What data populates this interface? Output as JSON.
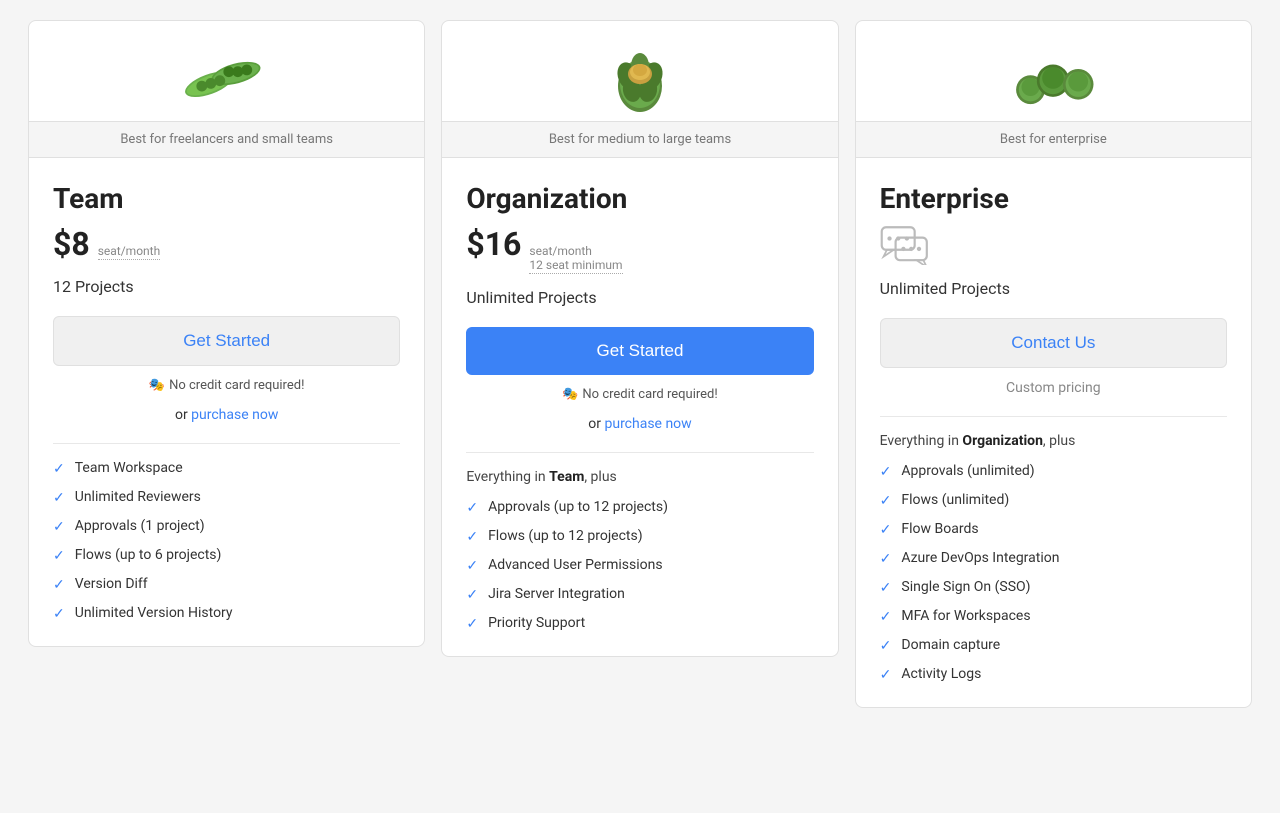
{
  "cards": [
    {
      "id": "team",
      "veggie": "🫛",
      "veggie_name": "edamame",
      "header": "Best for freelancers and small teams",
      "plan_name": "Team",
      "price": "$8",
      "price_detail_line1": "seat/month",
      "price_detail_line2": "",
      "projects": "12 Projects",
      "btn_label": "Get Started",
      "btn_style": "outline",
      "no_credit": "No credit card required!",
      "purchase_prefix": "or",
      "purchase_label": "purchase now",
      "features_intro": "",
      "features_intro_bold": "",
      "features_intro_suffix": "",
      "features": [
        "Team Workspace",
        "Unlimited Reviewers",
        "Approvals (1 project)",
        "Flows (up to 6 projects)",
        "Version Diff",
        "Unlimited Version History"
      ],
      "has_chat_icon": false,
      "has_custom_pricing": false
    },
    {
      "id": "organization",
      "veggie": "🥦",
      "veggie_name": "artichoke",
      "header": "Best for medium to large teams",
      "plan_name": "Organization",
      "price": "$16",
      "price_detail_line1": "seat/month",
      "price_detail_line2": "12 seat minimum",
      "projects": "Unlimited Projects",
      "btn_label": "Get Started",
      "btn_style": "solid",
      "no_credit": "No credit card required!",
      "purchase_prefix": "or",
      "purchase_label": "purchase now",
      "features_intro_prefix": "Everything in ",
      "features_intro_bold": "Team",
      "features_intro_suffix": ", plus",
      "features": [
        "Approvals (up to 12 projects)",
        "Flows (up to 12 projects)",
        "Advanced User Permissions",
        "Jira Server Integration",
        "Priority Support"
      ],
      "has_chat_icon": false,
      "has_custom_pricing": false
    },
    {
      "id": "enterprise",
      "veggie": "🥬",
      "veggie_name": "brussels-sprouts",
      "header": "Best for enterprise",
      "plan_name": "Enterprise",
      "price": "",
      "price_detail_line1": "",
      "price_detail_line2": "",
      "projects": "Unlimited Projects",
      "btn_label": "Contact Us",
      "btn_style": "contact",
      "no_credit": "",
      "purchase_prefix": "",
      "purchase_label": "",
      "custom_pricing": "Custom pricing",
      "features_intro_prefix": "Everything in ",
      "features_intro_bold": "Organization",
      "features_intro_suffix": ", plus",
      "features": [
        "Approvals (unlimited)",
        "Flows (unlimited)",
        "Flow Boards",
        "Azure DevOps Integration",
        "Single Sign On (SSO)",
        "MFA for Workspaces",
        "Domain capture",
        "Activity Logs"
      ],
      "has_chat_icon": true,
      "has_custom_pricing": true
    }
  ],
  "icons": {
    "check": "✓",
    "no_credit_emoji": "🎭"
  }
}
